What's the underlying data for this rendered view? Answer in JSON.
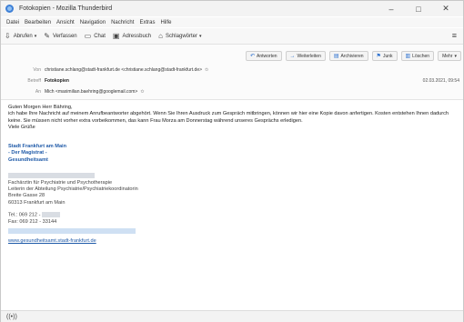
{
  "window": {
    "title": "Fotokopien - Mozilla Thunderbird",
    "controls": [
      "–",
      "□",
      "✕"
    ]
  },
  "menu": [
    "Datei",
    "Bearbeiten",
    "Ansicht",
    "Navigation",
    "Nachricht",
    "Extras",
    "Hilfe"
  ],
  "toolbar": {
    "get_messages": "Abrufen",
    "write": "Verfassen",
    "chat": "Chat",
    "address_book": "Adressbuch",
    "tags": "Schlagwörter"
  },
  "header": {
    "actions": [
      "Antworten",
      "Weiterleiten",
      "Archivieren",
      "Junk",
      "Löschen",
      "Mehr"
    ],
    "from_label": "Von",
    "from": "christiane.schlang@stadt-frankfurt.de <christiane.schlang@stadt-frankfurt.de>",
    "subject_label": "Betreff",
    "subject": "Fotokopien",
    "date": "02.03.2021, 09:54",
    "to_label": "An",
    "to": "Mich <maximilian.baehring@googlemail.com>"
  },
  "body": {
    "greeting": "Guten Morgen Herr Bähring,",
    "para1": "ich habe Ihre Nachricht auf meinem Anrufbeantworter abgehört. Wenn Sie Ihren Ausdruck zum Gespräch mitbringen, können wir hier eine Kopie davon anfertigen. Kosten entstehen Ihnen dadurch keine. Sie müssen nicht vorher extra vorbeikommen, das kann Frau Morza am Donnerstag während unseres Gesprächs erledigen.",
    "closing": "Viele Grüße",
    "sig_org1": "Stadt Frankfurt am Main",
    "sig_org2": "- Der Magistrat -",
    "sig_org3": "Gesundheitsamt",
    "sig_lines": [
      "Fachärztin für Psychiatrie und Psychotherapie",
      "Leiterin der Abteilung Psychiatrie/Psychiatriekoordinatorin",
      "Breite Gasse 28",
      "60313 Frankfurt am Main"
    ],
    "tel": "Tel.: 069 212 -",
    "fax": "Fax: 069 212 - 33144",
    "website": "www.gesundheitsamt.stadt-frankfurt.de"
  }
}
